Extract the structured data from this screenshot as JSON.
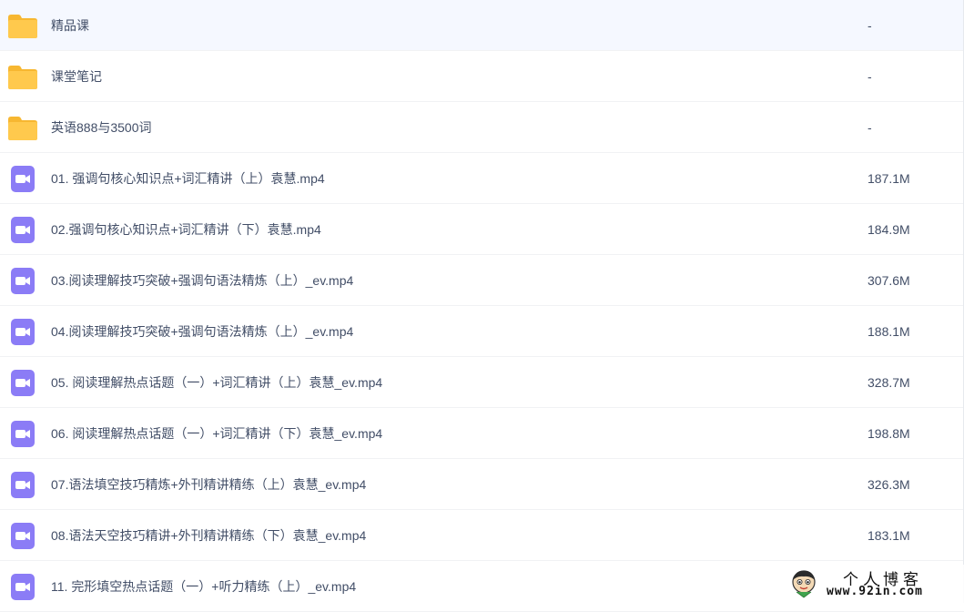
{
  "files": [
    {
      "type": "folder",
      "name": "精品课",
      "size": "-"
    },
    {
      "type": "folder",
      "name": "课堂笔记",
      "size": "-"
    },
    {
      "type": "folder",
      "name": "英语888与3500词",
      "size": "-"
    },
    {
      "type": "video",
      "name": "01. 强调句核心知识点+词汇精讲（上）袁慧.mp4",
      "size": "187.1M"
    },
    {
      "type": "video",
      "name": "02.强调句核心知识点+词汇精讲（下）袁慧.mp4",
      "size": "184.9M"
    },
    {
      "type": "video",
      "name": "03.阅读理解技巧突破+强调句语法精炼（上）_ev.mp4",
      "size": "307.6M"
    },
    {
      "type": "video",
      "name": "04.阅读理解技巧突破+强调句语法精炼（上）_ev.mp4",
      "size": "188.1M"
    },
    {
      "type": "video",
      "name": "05. 阅读理解热点话题（一）+词汇精讲（上）袁慧_ev.mp4",
      "size": "328.7M"
    },
    {
      "type": "video",
      "name": "06. 阅读理解热点话题（一）+词汇精讲（下）袁慧_ev.mp4",
      "size": "198.8M"
    },
    {
      "type": "video",
      "name": "07.语法填空技巧精炼+外刊精讲精练（上）袁慧_ev.mp4",
      "size": "326.3M"
    },
    {
      "type": "video",
      "name": "08.语法天空技巧精讲+外刊精讲精练（下）袁慧_ev.mp4",
      "size": "183.1M"
    },
    {
      "type": "video",
      "name": "11. 完形填空热点话题（一）+听力精练（上）_ev.mp4",
      "size": ""
    }
  ],
  "watermark": {
    "title": "个人博客",
    "url": "www.92in.com"
  },
  "colors": {
    "folder": "#ffc94d",
    "folder_tab": "#f7b731",
    "video": "#8b7cf6",
    "text": "#424e67"
  }
}
